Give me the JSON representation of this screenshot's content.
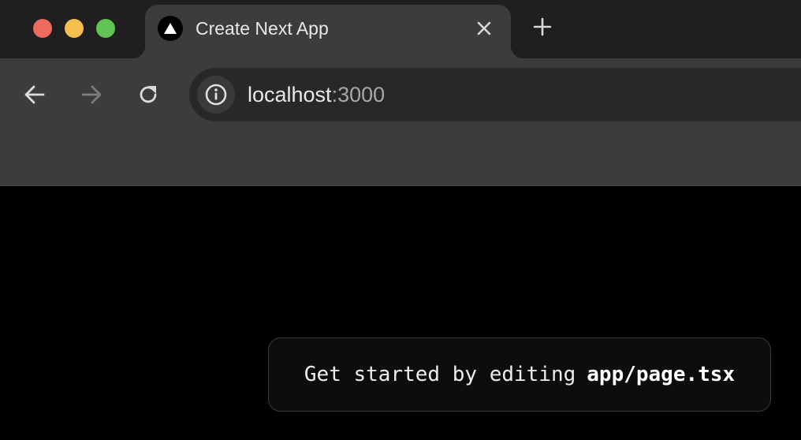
{
  "window_controls": {
    "close": "#ed6a5e",
    "minimize": "#f5bf4f",
    "maximize": "#61c554"
  },
  "tab": {
    "title": "Create Next App",
    "favicon": "triangle-icon",
    "close_icon": "close-icon"
  },
  "new_tab_icon": "plus-icon",
  "toolbar": {
    "back_icon": "arrow-left-icon",
    "forward_icon": "arrow-right-icon",
    "reload_icon": "reload-icon"
  },
  "address_bar": {
    "site_info_icon": "info-icon",
    "host": "localhost",
    "port": ":3000"
  },
  "page": {
    "hint_text": "Get started by editing",
    "hint_code": "app/page.tsx"
  }
}
